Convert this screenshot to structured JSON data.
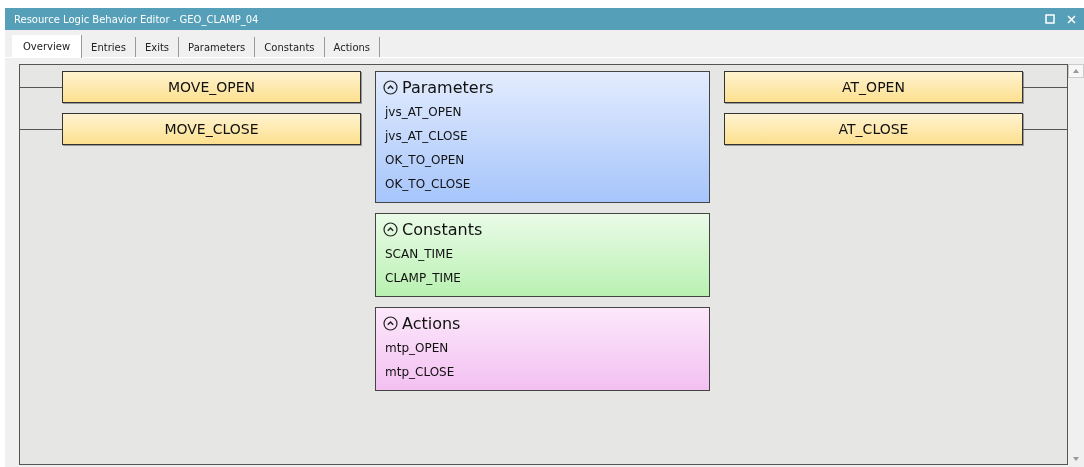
{
  "window": {
    "title": "Resource Logic Behavior Editor - GEO_CLAMP_04"
  },
  "tabs": [
    {
      "label": "Overview",
      "selected": true
    },
    {
      "label": "Entries",
      "selected": false
    },
    {
      "label": "Exits",
      "selected": false
    },
    {
      "label": "Parameters",
      "selected": false
    },
    {
      "label": "Constants",
      "selected": false
    },
    {
      "label": "Actions",
      "selected": false
    }
  ],
  "entries": [
    "MOVE_OPEN",
    "MOVE_CLOSE"
  ],
  "panels": [
    {
      "kind": "parameters",
      "title": "Parameters",
      "expanded": true,
      "items": [
        "jvs_AT_OPEN",
        "jvs_AT_CLOSE",
        "OK_TO_OPEN",
        "OK_TO_CLOSE"
      ]
    },
    {
      "kind": "constants",
      "title": "Constants",
      "expanded": true,
      "items": [
        "SCAN_TIME",
        "CLAMP_TIME"
      ]
    },
    {
      "kind": "actions",
      "title": "Actions",
      "expanded": true,
      "items": [
        "mtp_OPEN",
        "mtp_CLOSE"
      ]
    }
  ],
  "exits": [
    "AT_OPEN",
    "AT_CLOSE"
  ]
}
